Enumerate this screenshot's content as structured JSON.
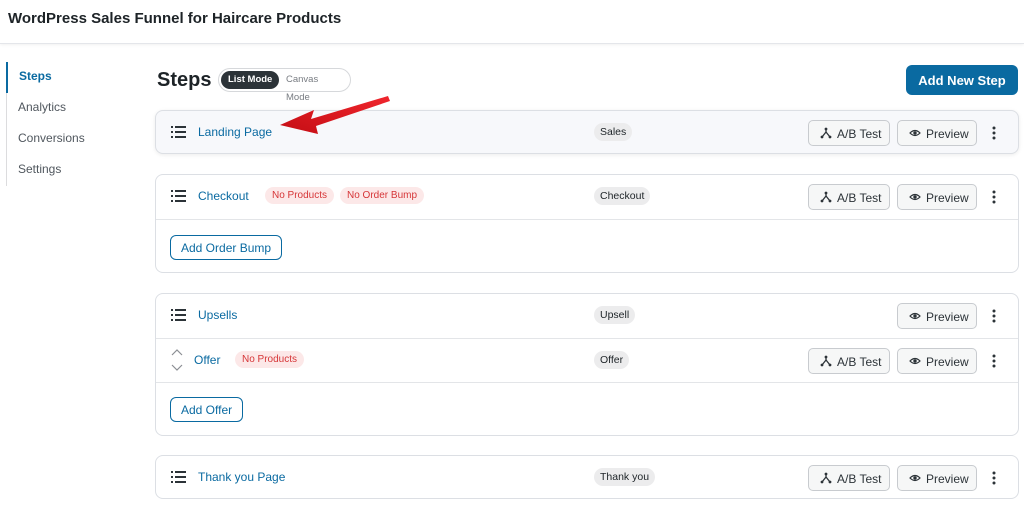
{
  "header": {
    "title": "WordPress Sales Funnel for Haircare Products"
  },
  "sidebar": {
    "items": [
      {
        "label": "Steps"
      },
      {
        "label": "Analytics"
      },
      {
        "label": "Conversions"
      },
      {
        "label": "Settings"
      }
    ]
  },
  "main": {
    "heading": "Steps",
    "modes": [
      {
        "label": "List Mode"
      },
      {
        "label": "Canvas Mode"
      }
    ],
    "add_step_label": "Add New Step"
  },
  "buttons": {
    "ab_test": "A/B Test",
    "preview": "Preview"
  },
  "steps": {
    "landing": {
      "name": "Landing Page",
      "type": "Sales"
    },
    "checkout": {
      "name": "Checkout",
      "badges": [
        "No Products",
        "No Order Bump"
      ],
      "type": "Checkout",
      "action": "Add Order Bump"
    },
    "upsells": {
      "name": "Upsells",
      "type": "Upsell",
      "offer": {
        "name": "Offer",
        "badge": "No Products",
        "type": "Offer"
      },
      "action": "Add Offer"
    },
    "thankyou": {
      "name": "Thank you Page",
      "type": "Thank you"
    }
  },
  "colors": {
    "accent": "#0a6aa1",
    "annotation_arrow": "#e8141c",
    "warning": "#d63638"
  }
}
